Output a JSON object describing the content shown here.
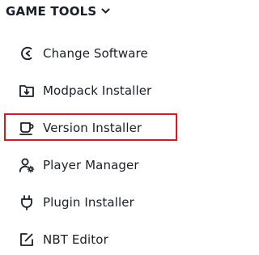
{
  "section": {
    "title": "GAME TOOLS",
    "chevron_icon": "chevron-down-icon"
  },
  "items": [
    {
      "label": "Change Software",
      "icon": "software-swap-icon"
    },
    {
      "label": "Modpack Installer",
      "icon": "folder-download-icon"
    },
    {
      "label": "Version Installer",
      "icon": "coffee-cup-icon"
    },
    {
      "label": "Player Manager",
      "icon": "user-gear-icon"
    },
    {
      "label": "Plugin Installer",
      "icon": "plug-icon"
    },
    {
      "label": "NBT Editor",
      "icon": "edit-square-icon"
    }
  ],
  "highlight": {
    "item_label": "Version Installer",
    "color": "#e0161e"
  },
  "colors": {
    "text": "#1a1f27",
    "background": "#ffffff"
  }
}
